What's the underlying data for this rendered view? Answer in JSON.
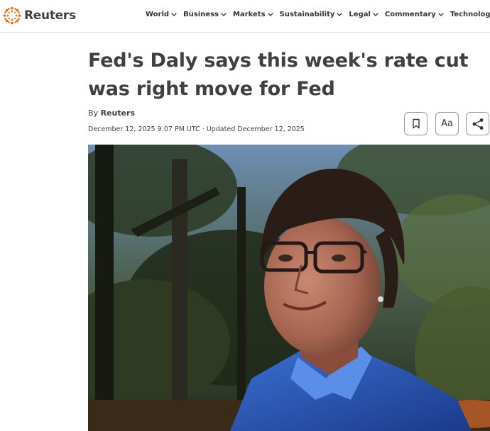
{
  "brand": {
    "name": "Reuters",
    "accent": "#fa6400"
  },
  "nav": {
    "items": [
      {
        "label": "World"
      },
      {
        "label": "Business"
      },
      {
        "label": "Markets"
      },
      {
        "label": "Sustainability"
      },
      {
        "label": "Legal"
      },
      {
        "label": "Commentary"
      },
      {
        "label": "Technology"
      }
    ]
  },
  "article": {
    "headline": "Fed's Daly says this week's rate cut was right move for Fed",
    "byline_prefix": "By",
    "author": "Reuters",
    "dateline": "December 12, 2025 9:07 PM UTC · Updated December 12, 2025"
  },
  "toolbar": {
    "bookmark_icon": "bookmark-icon",
    "font_label": "Aa",
    "share_icon": "share-icon"
  }
}
